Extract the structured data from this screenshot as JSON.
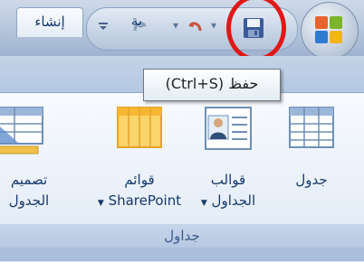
{
  "tabs": [
    {
      "label": "إنشاء",
      "active": true
    },
    {
      "label": "ية",
      "active": false
    }
  ],
  "tooltip": {
    "text": "حفظ (Ctrl+S)"
  },
  "qat": {
    "items": [
      "customize-arrow-icon",
      "redo-icon",
      "undo-icon",
      "save-icon"
    ]
  },
  "ribbon": {
    "group_label": "جداول",
    "buttons": [
      {
        "name": "table",
        "label_line1": "جدول",
        "label_line2": ""
      },
      {
        "name": "table-templates",
        "label_line1": "قوالب",
        "label_line2": "الجداول"
      },
      {
        "name": "sharepoint-lists",
        "label_line1": "قوائم",
        "label_line2": "SharePoint"
      },
      {
        "name": "table-design",
        "label_line1": "تصميم",
        "label_line2": "الجدول"
      }
    ]
  },
  "colors": {
    "highlight": "#e01818",
    "tab_text": "#163a72",
    "ribbon_text": "#17396b"
  }
}
